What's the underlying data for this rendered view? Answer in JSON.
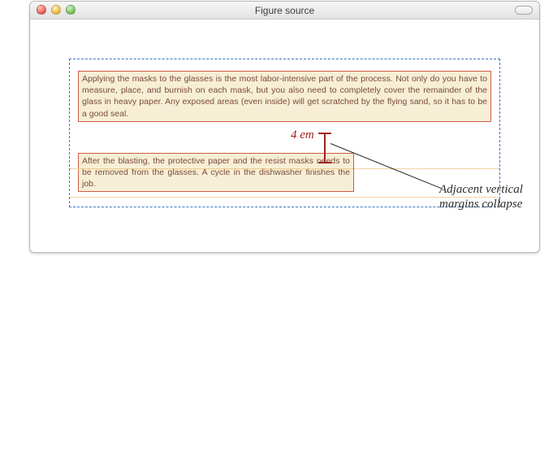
{
  "window": {
    "title": "Figure source"
  },
  "paragraphs": {
    "p1": "Applying the masks to the glasses is the most labor-intensive part of the process. Not only do you have to measure, place, and burnish on each mask, but you also need to completely cover the remainder of the glass in heavy paper. Any exposed areas (even inside) will get scratched by the flying sand, so it has to be a good seal.",
    "p2": "After the blasting, the protective paper and the resist masks needs to be removed from the glasses. A cycle in the dishwasher finishes the job."
  },
  "annotations": {
    "gap_label": "4 em",
    "callout": "Adjacent vertical margins collapse"
  }
}
